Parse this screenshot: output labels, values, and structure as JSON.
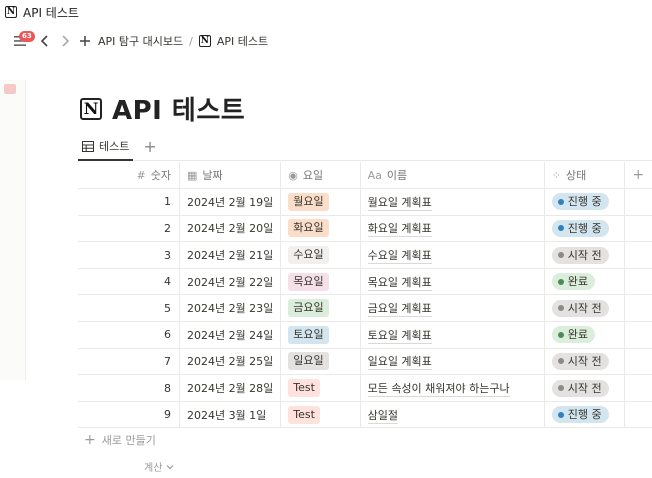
{
  "window": {
    "title": "API 테스트"
  },
  "nav": {
    "badge": "63",
    "breadcrumb": [
      "API 탐구 대시보드",
      "API 테스트"
    ],
    "separator": "/"
  },
  "page": {
    "title": "API 테스트"
  },
  "view": {
    "tab_label": "테스트",
    "add_label": "+"
  },
  "table": {
    "columns": [
      {
        "icon": "#",
        "label": "숫자"
      },
      {
        "icon": "▦",
        "label": "날짜"
      },
      {
        "icon": "◉",
        "label": "요일"
      },
      {
        "icon": "Aa",
        "label": "이름"
      },
      {
        "icon": "⁘",
        "label": "상태"
      }
    ],
    "add_column": "+",
    "rows": [
      {
        "num": "1",
        "date": "2024년 2월 19일",
        "day": "월요일",
        "day_color": "#fadec9",
        "name": "월요일 계획표",
        "status": "진행 중",
        "status_bg": "#d3e5ef",
        "status_dot": "#2f80c2"
      },
      {
        "num": "2",
        "date": "2024년 2월 20일",
        "day": "화요일",
        "day_color": "#fadec9",
        "name": "화요일 계획표",
        "status": "진행 중",
        "status_bg": "#d3e5ef",
        "status_dot": "#2f80c2"
      },
      {
        "num": "3",
        "date": "2024년 2월 21일",
        "day": "수요일",
        "day_color": "#f1f0ef",
        "name": "수요일 계획표",
        "status": "시작 전",
        "status_bg": "#e3e2e0",
        "status_dot": "#8e8b86"
      },
      {
        "num": "4",
        "date": "2024년 2월 22일",
        "day": "목요일",
        "day_color": "#f5e0e9",
        "name": "목요일 계획표",
        "status": "완료",
        "status_bg": "#dbeddb",
        "status_dot": "#4d8a5a"
      },
      {
        "num": "5",
        "date": "2024년 2월 23일",
        "day": "금요일",
        "day_color": "#dbeddb",
        "name": "금요일 계획표",
        "status": "시작 전",
        "status_bg": "#e3e2e0",
        "status_dot": "#8e8b86"
      },
      {
        "num": "6",
        "date": "2024년 2월 24일",
        "day": "토요일",
        "day_color": "#d3e5ef",
        "name": "토요일 계획표",
        "status": "완료",
        "status_bg": "#dbeddb",
        "status_dot": "#4d8a5a"
      },
      {
        "num": "7",
        "date": "2024년 2월 25일",
        "day": "일요일",
        "day_color": "#e3e2e0",
        "name": "일요일 계획표",
        "status": "시작 전",
        "status_bg": "#e3e2e0",
        "status_dot": "#8e8b86"
      },
      {
        "num": "8",
        "date": "2024년 2월 28일",
        "day": "Test",
        "day_color": "#ffe2dd",
        "name": "모든 속성이 채워져야 하는구나",
        "status": "시작 전",
        "status_bg": "#e3e2e0",
        "status_dot": "#8e8b86"
      },
      {
        "num": "9",
        "date": "2024년 3월 1일",
        "day": "Test",
        "day_color": "#ffe2dd",
        "name": "삼일절",
        "status": "진행 중",
        "status_bg": "#d3e5ef",
        "status_dot": "#2f80c2"
      }
    ]
  },
  "footer": {
    "new_row": "새로 만들기",
    "calculate": "계산"
  },
  "colors": {
    "accent_red": "#eb5757",
    "text": "#37352f",
    "muted": "#9b9a97"
  }
}
